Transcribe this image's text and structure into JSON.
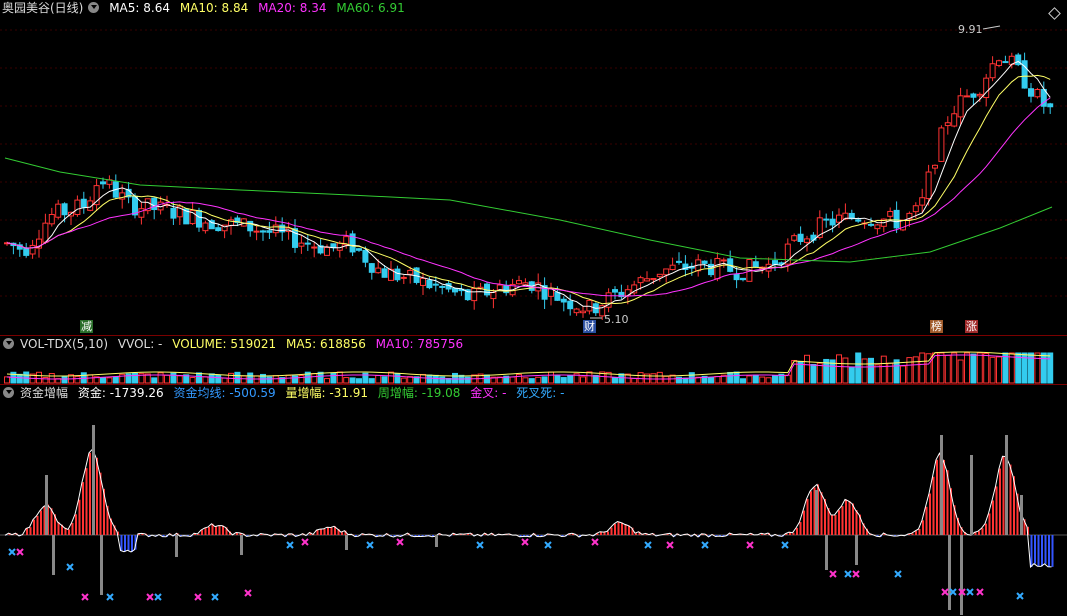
{
  "main": {
    "title": "奥园美谷(日线)",
    "ma5": "MA5: 8.64",
    "ma10": "MA10: 8.84",
    "ma20": "MA20: 8.34",
    "ma60": "MA60: 6.91",
    "high_label": "9.91",
    "low_label": "5.10",
    "tags": [
      "减",
      "财",
      "榜",
      "涨"
    ]
  },
  "vol": {
    "title": "VOL-TDX(5,10)",
    "vvol": "VVOL: -",
    "volume": "VOLUME: 519021",
    "ma5": "MA5: 618856",
    "ma10": "MA10: 785756"
  },
  "fund": {
    "title": "资金增幅",
    "zj": "资金: -1739.26",
    "zjjx": "资金均线: -500.59",
    "lzf": "量增幅: -31.91",
    "zzf": "周增幅: -19.08",
    "jc": "金叉: -",
    "sc": "死叉死: -"
  },
  "colors": {
    "up": "#ff3333",
    "down": "#33ccee",
    "ma5": "#ffffff",
    "ma10": "#ffff66",
    "ma20": "#ff33ff",
    "ma60": "#33cc33",
    "cross1": "#ff33cc",
    "cross2": "#33aaff"
  }
}
